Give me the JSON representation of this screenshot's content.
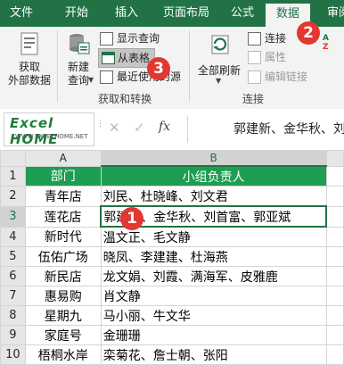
{
  "tabs": [
    "文件",
    "开始",
    "插入",
    "页面布局",
    "公式",
    "数据",
    "审阅"
  ],
  "active_tab": "数据",
  "ribbon": {
    "get_external_data": "获取\n外部数据",
    "new_query": "新建\n查询",
    "show_queries": "显示查询",
    "from_table": "从表格",
    "recent_sources": "最近使用的源",
    "group_get_transform": "获取和转换",
    "refresh_all": "全部刷新",
    "connections": "连接",
    "properties": "属性",
    "edit_links": "编辑链接",
    "group_connections": "连接"
  },
  "formula_bar": {
    "logo_text": "Excel HOME",
    "logo_url": "WWW.EXCELHOME.NET",
    "cancel_symbol": "✕",
    "enter_symbol": "✓",
    "fx_label": "fx",
    "content": "郭建新、金华秋、刘首富、郭亚斌"
  },
  "grid": {
    "column_headers": [
      "A",
      "B"
    ],
    "row_numbers": [
      "1",
      "2",
      "3",
      "4",
      "5",
      "6",
      "7",
      "8",
      "9",
      "10"
    ],
    "selected_row": "3",
    "rows": [
      {
        "a": "部门",
        "b": "小组负责人"
      },
      {
        "a": "青年店",
        "b": "刘民、杜晓峰、刘文君"
      },
      {
        "a": "莲花店",
        "b": "郭建新、金华秋、刘首富、郭亚斌"
      },
      {
        "a": "新时代",
        "b": "温文正、毛文静"
      },
      {
        "a": "伍佑广场",
        "b": "晓凤、李建建、杜海燕"
      },
      {
        "a": "新民店",
        "b": "龙文娟、刘霞、满海军、皮雅鹿"
      },
      {
        "a": "惠易购",
        "b": "肖文静"
      },
      {
        "a": "星期九",
        "b": "马小丽、牛文华"
      },
      {
        "a": "家庭号",
        "b": "金珊珊"
      },
      {
        "a": "梧桐水岸",
        "b": "栾菊花、詹士朝、张阳"
      }
    ]
  },
  "badges": [
    "1",
    "2",
    "3"
  ],
  "colors": {
    "excel_green": "#217346",
    "header_fill": "#1e9e52",
    "badge_red": "#e2382f"
  }
}
